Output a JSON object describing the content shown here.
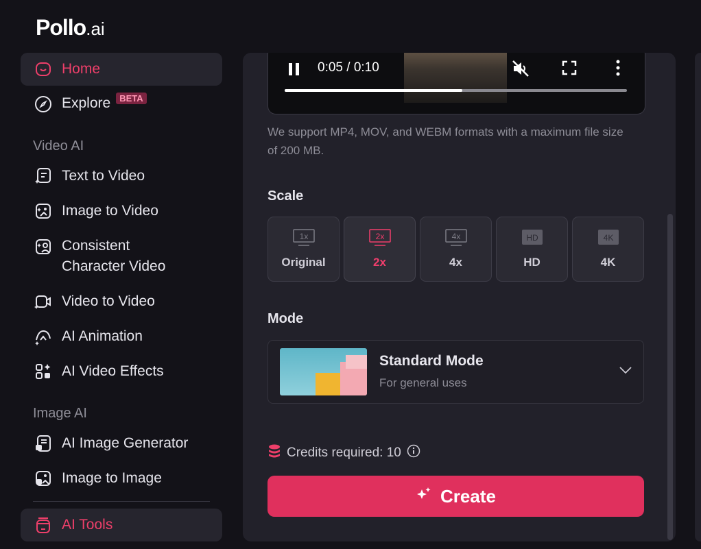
{
  "brand": {
    "name_bold": "Pollo",
    "name_suffix": ".ai"
  },
  "sidebar": {
    "home": "Home",
    "explore": "Explore",
    "explore_badge": "BETA",
    "video_section": "Video AI",
    "video_items": [
      "Text to Video",
      "Image to Video",
      "Consistent",
      "Character Video",
      "Video to Video",
      "AI Animation",
      "AI Video Effects"
    ],
    "image_section": "Image AI",
    "image_items": [
      "AI Image Generator",
      "Image to Image"
    ],
    "tools": "AI Tools"
  },
  "player": {
    "time": "0:05 / 0:10",
    "progress": 0.52
  },
  "upload_hint": "We support MP4, MOV, and WEBM formats with a maximum file size of 200 MB.",
  "scale": {
    "label": "Scale",
    "options": [
      {
        "tag": "1x",
        "name": "Original",
        "selected": false
      },
      {
        "tag": "2x",
        "name": "2x",
        "selected": true
      },
      {
        "tag": "4x",
        "name": "4x",
        "selected": false
      },
      {
        "tag": "HD",
        "name": "HD",
        "selected": false
      },
      {
        "tag": "4K",
        "name": "4K",
        "selected": false
      }
    ]
  },
  "mode": {
    "label": "Mode",
    "title": "Standard Mode",
    "subtitle": "For general uses"
  },
  "credits": {
    "text": "Credits required: 10"
  },
  "create_label": "Create",
  "colors": {
    "accent": "#e0305d",
    "active_text": "#ee3f6a",
    "panel": "#22212a",
    "background": "#131218"
  }
}
